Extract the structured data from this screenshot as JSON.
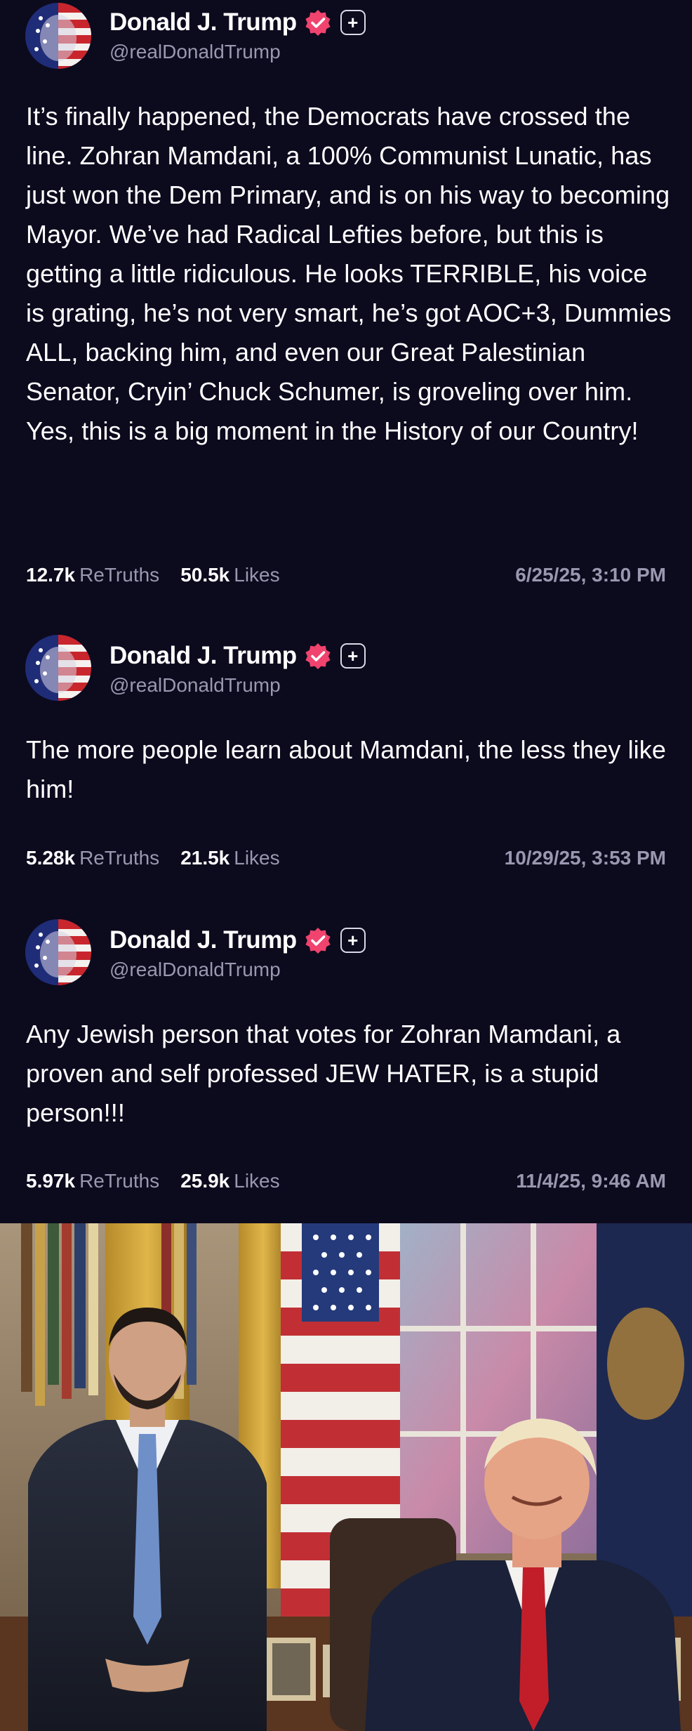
{
  "posts": [
    {
      "author": {
        "name": "Donald J. Trump",
        "handle": "@realDonaldTrump",
        "avatar_icon": "flag-face-avatar",
        "verified_icon": "verified-badge-icon",
        "follow_icon": "plus-icon"
      },
      "text": "It’s finally happened, the Democrats have crossed the line. Zohran Mamdani, a 100% Communist Lunatic, has just won the Dem Primary, and is on his way to becoming Mayor. We’ve had Radical Lefties before, but this is getting a little ridiculous. He looks TERRIBLE, his voice is grating, he’s not very smart, he’s got AOC+3, Dummies ALL, backing him, and even our Great Palestinian Senator, Cryin’ Chuck Schumer, is groveling over him. Yes, this is a big moment in the History of our Country!",
      "retruths": "12.7k",
      "retruths_label": "ReTruths",
      "likes": "50.5k",
      "likes_label": "Likes",
      "timestamp": "6/25/25, 3:10 PM"
    },
    {
      "author": {
        "name": "Donald J. Trump",
        "handle": "@realDonaldTrump",
        "avatar_icon": "flag-face-avatar",
        "verified_icon": "verified-badge-icon",
        "follow_icon": "plus-icon"
      },
      "text": "The more people learn about Mamdani, the less they like him!",
      "retruths": "5.28k",
      "retruths_label": "ReTruths",
      "likes": "21.5k",
      "likes_label": "Likes",
      "timestamp": "10/29/25, 3:53 PM"
    },
    {
      "author": {
        "name": "Donald J. Trump",
        "handle": "@realDonaldTrump",
        "avatar_icon": "flag-face-avatar",
        "verified_icon": "verified-badge-icon",
        "follow_icon": "plus-icon"
      },
      "text": "Any Jewish person that votes for Zohran Mamdani, a proven and self professed JEW HATER, is a stupid person!!!",
      "retruths": "5.97k",
      "retruths_label": "ReTruths",
      "likes": "25.9k",
      "likes_label": "Likes",
      "timestamp": "11/4/25, 9:46 AM"
    }
  ],
  "photo": {
    "subject": "two-men-oval-office-photo"
  },
  "colors": {
    "background": "#0c0a1d",
    "muted_text": "#9a98b0",
    "verified_badge": "#f0436e"
  },
  "glyphs": {
    "plus": "+"
  }
}
